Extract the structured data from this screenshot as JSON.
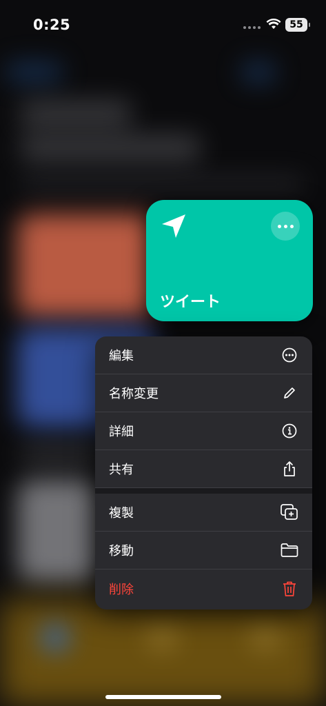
{
  "status_bar": {
    "time": "0:25",
    "battery": "55"
  },
  "shortcut": {
    "name": "ツイート",
    "color": "#00c6a8",
    "icon": "paper-plane-icon"
  },
  "menu": {
    "group1": [
      {
        "label": "編集",
        "icon": "ellipsis-circle-icon"
      },
      {
        "label": "名称変更",
        "icon": "pencil-icon"
      },
      {
        "label": "詳細",
        "icon": "info-circle-icon"
      },
      {
        "label": "共有",
        "icon": "share-icon"
      }
    ],
    "group2": [
      {
        "label": "複製",
        "icon": "duplicate-icon"
      },
      {
        "label": "移動",
        "icon": "folder-icon"
      },
      {
        "label": "削除",
        "icon": "trash-icon",
        "destructive": true,
        "color": "#ff453a"
      }
    ]
  }
}
